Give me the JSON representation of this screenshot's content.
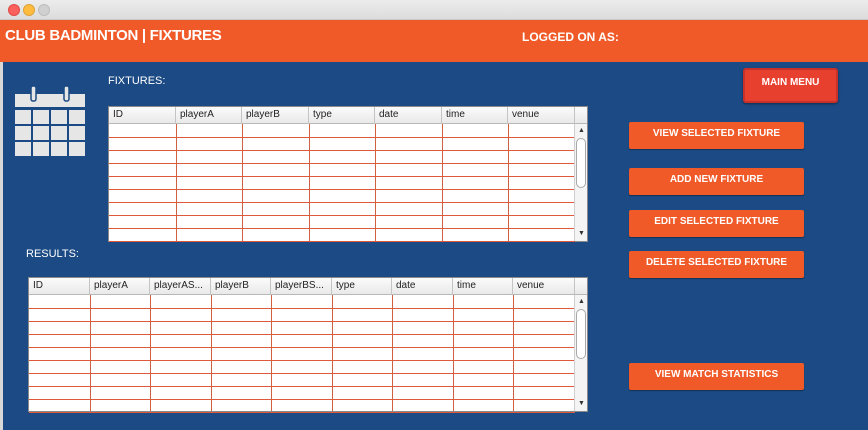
{
  "header": {
    "title": "CLUB BADMINTON | FIXTURES",
    "logged_on": "LOGGED ON AS:"
  },
  "fixtures": {
    "label": "FIXTURES:",
    "columns": [
      "ID",
      "playerA",
      "playerB",
      "type",
      "date",
      "time",
      "venue"
    ],
    "rows": []
  },
  "results": {
    "label": "RESULTS:",
    "columns": [
      "ID",
      "playerA",
      "playerAS...",
      "playerB",
      "playerBS...",
      "type",
      "date",
      "time",
      "venue"
    ],
    "rows": []
  },
  "buttons": {
    "main_menu": "MAIN MENU",
    "view_fixture": "VIEW SELECTED FIXTURE",
    "add_fixture": "ADD NEW FIXTURE",
    "edit_fixture": "EDIT SELECTED FIXTURE",
    "delete_fixture": "DELETE SELECTED FIXTURE",
    "view_stats": "VIEW MATCH STATISTICS"
  },
  "icons": {
    "calendar": "calendar-icon"
  },
  "colors": {
    "accent": "#f05a28",
    "background": "#1b4a84",
    "grid": "#e05a3a"
  }
}
